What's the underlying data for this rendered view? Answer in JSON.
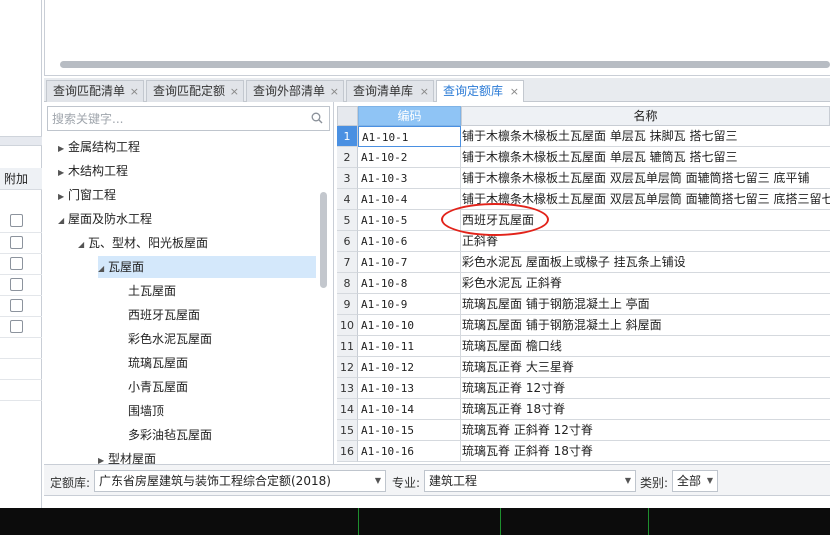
{
  "left_strip": {
    "add_label": "附加",
    "checkbox_count": 6
  },
  "tabs": [
    {
      "label": "查询匹配清单",
      "close": "×"
    },
    {
      "label": "查询匹配定额",
      "close": "×"
    },
    {
      "label": "查询外部清单",
      "close": "×"
    },
    {
      "label": "查询清单库",
      "close": "×"
    },
    {
      "label": "查询定额库",
      "close": "×",
      "active": true
    }
  ],
  "search": {
    "placeholder": "搜索关键字..."
  },
  "tree": [
    {
      "label": "金属结构工程",
      "arrow": "▶"
    },
    {
      "label": "木结构工程",
      "arrow": "▶"
    },
    {
      "label": "门窗工程",
      "arrow": "▶"
    },
    {
      "label": "屋面及防水工程",
      "arrow": "◢"
    },
    {
      "label": "瓦、型材、阳光板屋面",
      "arrow": "◢"
    },
    {
      "label": "瓦屋面",
      "arrow": "◢",
      "selected": true
    },
    {
      "label": "土瓦屋面",
      "arrow": ""
    },
    {
      "label": "西班牙瓦屋面",
      "arrow": ""
    },
    {
      "label": "彩色水泥瓦屋面",
      "arrow": ""
    },
    {
      "label": "琉璃瓦屋面",
      "arrow": ""
    },
    {
      "label": "小青瓦屋面",
      "arrow": ""
    },
    {
      "label": "围墙顶",
      "arrow": ""
    },
    {
      "label": "多彩油毡瓦屋面",
      "arrow": ""
    },
    {
      "label": "型材屋面",
      "arrow": "▶"
    }
  ],
  "grid": {
    "col_code": "编码",
    "col_name": "名称",
    "rows": [
      {
        "n": "1",
        "code": "A1-10-1",
        "name": "铺于木檩条木椽板土瓦屋面 单层瓦 抹脚瓦 搭七留三"
      },
      {
        "n": "2",
        "code": "A1-10-2",
        "name": "铺于木檩条木椽板土瓦屋面 单层瓦 辘筒瓦 搭七留三"
      },
      {
        "n": "3",
        "code": "A1-10-3",
        "name": "铺于木檩条木椽板土瓦屋面 双层瓦单层筒 面辘筒搭七留三 底平铺"
      },
      {
        "n": "4",
        "code": "A1-10-4",
        "name": "铺于木檩条木椽板土瓦屋面 双层瓦单层筒 面辘筒搭七留三 底搭三留七"
      },
      {
        "n": "5",
        "code": "A1-10-5",
        "name": "西班牙瓦屋面"
      },
      {
        "n": "6",
        "code": "A1-10-6",
        "name": "正斜脊"
      },
      {
        "n": "7",
        "code": "A1-10-7",
        "name": "彩色水泥瓦 屋面板上或椽子 挂瓦条上铺设"
      },
      {
        "n": "8",
        "code": "A1-10-8",
        "name": "彩色水泥瓦 正斜脊"
      },
      {
        "n": "9",
        "code": "A1-10-9",
        "name": "琉璃瓦屋面 铺于钢筋混凝土上 亭面"
      },
      {
        "n": "10",
        "code": "A1-10-10",
        "name": "琉璃瓦屋面 铺于钢筋混凝土上 斜屋面"
      },
      {
        "n": "11",
        "code": "A1-10-11",
        "name": "琉璃瓦屋面 檐口线"
      },
      {
        "n": "12",
        "code": "A1-10-12",
        "name": "琉璃瓦正脊 大三星脊"
      },
      {
        "n": "13",
        "code": "A1-10-13",
        "name": "琉璃瓦正脊 12寸脊"
      },
      {
        "n": "14",
        "code": "A1-10-14",
        "name": "琉璃瓦正脊 18寸脊"
      },
      {
        "n": "15",
        "code": "A1-10-15",
        "name": "琉璃瓦脊 正斜脊 12寸脊"
      },
      {
        "n": "16",
        "code": "A1-10-16",
        "name": "琉璃瓦脊 正斜脊 18寸脊"
      }
    ]
  },
  "bottom": {
    "lib_label": "定额库:",
    "lib_value": "广东省房屋建筑与装饰工程综合定额(2018)",
    "spec_label": "专业:",
    "spec_value": "建筑工程",
    "cat_label": "类别:",
    "cat_value": "全部"
  },
  "colors": {
    "accent": "#2b7bd6",
    "header_blue": "#8fc4f5",
    "highlight": "#e2231a"
  }
}
